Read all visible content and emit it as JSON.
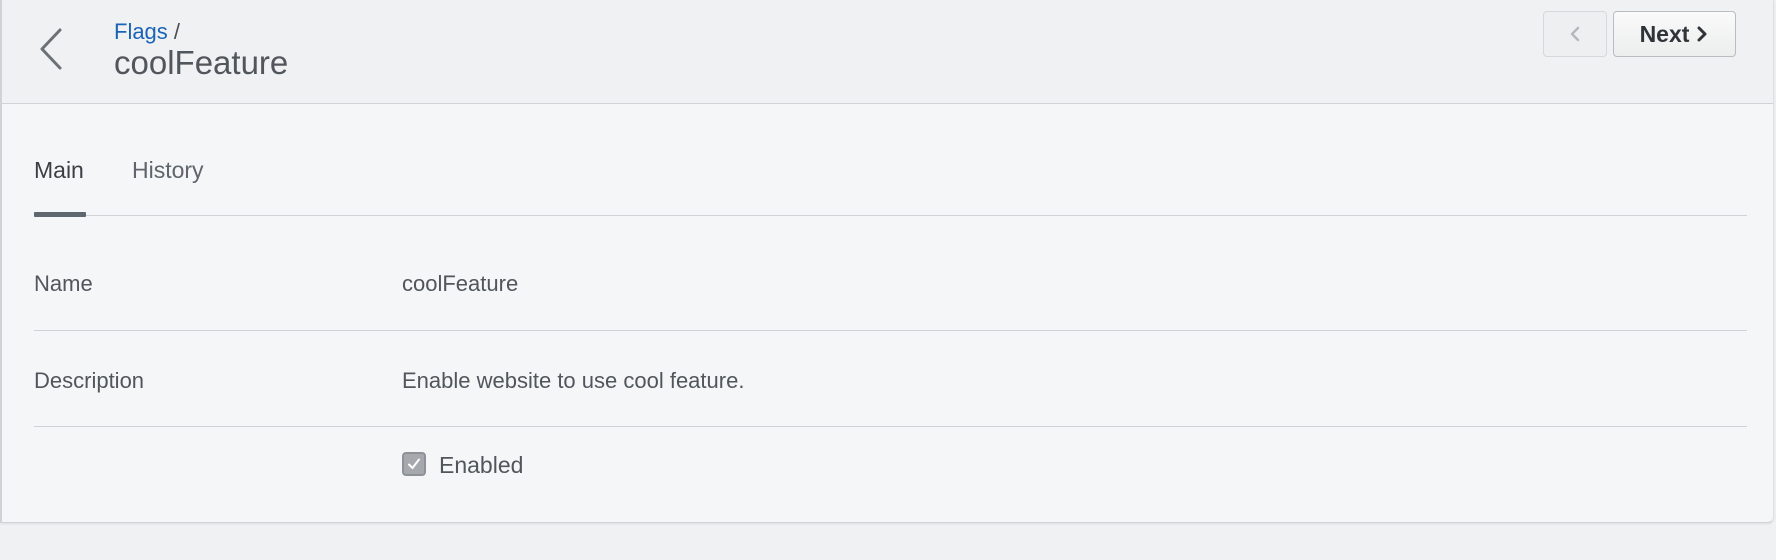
{
  "header": {
    "breadcrumb_link": "Flags",
    "breadcrumb_separator": "/",
    "title": "coolFeature",
    "back_icon": "chevron-left-icon",
    "prev_icon": "chevron-left-icon",
    "next_label": "Next",
    "next_icon": "chevron-right-icon"
  },
  "tabs": [
    {
      "label": "Main",
      "active": true
    },
    {
      "label": "History",
      "active": false
    }
  ],
  "fields": {
    "name_label": "Name",
    "name_value": "coolFeature",
    "description_label": "Description",
    "description_value": "Enable website to use cool feature.",
    "enabled_label": "Enabled",
    "enabled_checked": true
  },
  "colors": {
    "link": "#1a64b8",
    "text": "#50565c",
    "tab_underline": "#5e666e"
  }
}
